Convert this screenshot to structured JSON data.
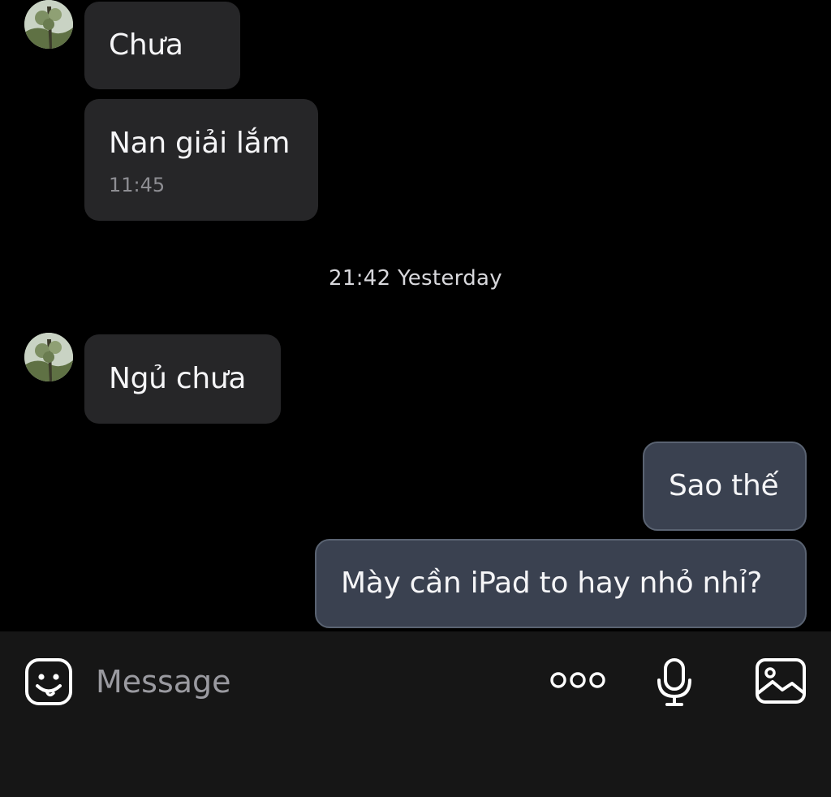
{
  "messages": [
    {
      "direction": "incoming",
      "text": "Chưa"
    },
    {
      "direction": "incoming",
      "text": "Nan giải lắm",
      "time": "11:45"
    },
    {
      "direction": "incoming",
      "text": "Ngủ chưa"
    },
    {
      "direction": "outgoing",
      "text": "Sao thế"
    },
    {
      "direction": "outgoing",
      "text": "Mày cần iPad to hay nhỏ nhỉ?"
    }
  ],
  "divider": {
    "label": "21:42 Yesterday"
  },
  "composer": {
    "placeholder": "Message",
    "icons": {
      "sticker": "sticker-icon",
      "more": "more-options-icon",
      "voice": "microphone-icon",
      "gallery": "image-gallery-icon"
    }
  },
  "colors": {
    "background": "#000000",
    "incoming_bubble": "#262628",
    "outgoing_bubble": "#3a4150",
    "composer_background": "#161616",
    "placeholder_text": "#9a9aa0"
  }
}
